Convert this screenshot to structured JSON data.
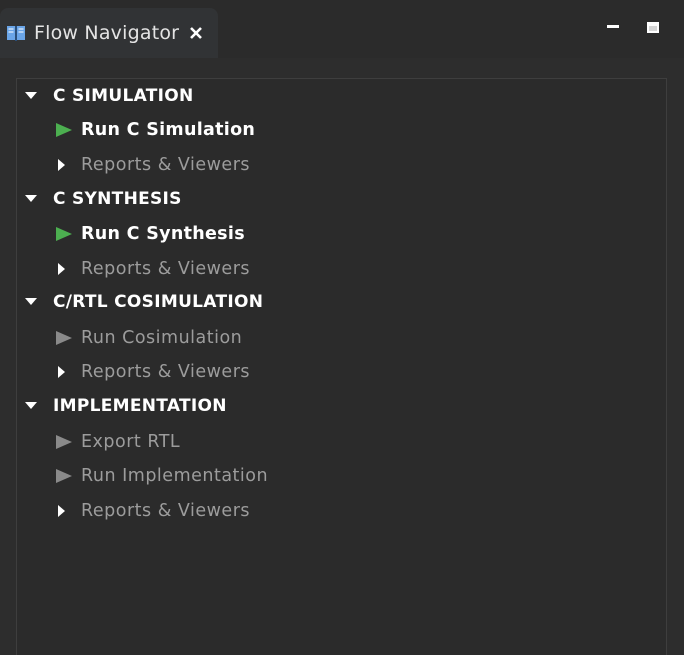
{
  "tab": {
    "title": "Flow Navigator",
    "icon": "book-icon",
    "close_icon": "close-icon"
  },
  "window_controls": {
    "minimize_icon": "minimize-icon",
    "maximize_icon": "maximize-icon"
  },
  "sections": [
    {
      "title": "C SIMULATION",
      "items": [
        {
          "label": "Run C Simulation",
          "type": "run",
          "enabled": true
        },
        {
          "label": "Reports & Viewers",
          "type": "expander",
          "enabled": false
        }
      ]
    },
    {
      "title": "C SYNTHESIS",
      "items": [
        {
          "label": "Run C Synthesis",
          "type": "run",
          "enabled": true
        },
        {
          "label": "Reports & Viewers",
          "type": "expander",
          "enabled": false
        }
      ]
    },
    {
      "title": "C/RTL COSIMULATION",
      "items": [
        {
          "label": "Run Cosimulation",
          "type": "run",
          "enabled": false
        },
        {
          "label": "Reports & Viewers",
          "type": "expander",
          "enabled": false
        }
      ]
    },
    {
      "title": "IMPLEMENTATION",
      "items": [
        {
          "label": "Export RTL",
          "type": "run",
          "enabled": false
        },
        {
          "label": "Run Implementation",
          "type": "run",
          "enabled": false
        },
        {
          "label": "Reports & Viewers",
          "type": "expander",
          "enabled": false
        }
      ]
    }
  ],
  "colors": {
    "run_enabled": "#4caf50",
    "run_disabled": "#8a8a8a",
    "background": "#2b2b2b"
  }
}
